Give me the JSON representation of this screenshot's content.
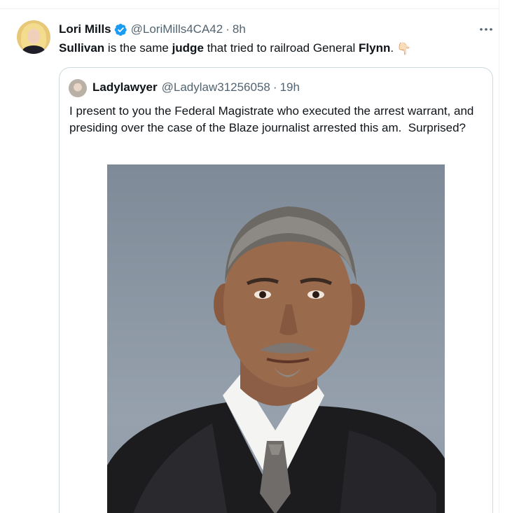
{
  "tweet": {
    "author_name": "Lori Mills",
    "handle": "@LoriMills4CA42",
    "separator": "·",
    "time": "8h",
    "more_icon": "more-horizontal-icon",
    "verified_icon": "verified-badge-icon",
    "text_parts": {
      "p1": "Sullivan",
      "p2": " is the same ",
      "p3": "judge",
      "p4": " that tried to railroad General ",
      "p5": "Flynn",
      "p6": "."
    },
    "emoji": "👇🏻"
  },
  "quote": {
    "author_name": "Ladylawyer",
    "handle": "@Ladylaw31256058",
    "separator": "·",
    "time": "19h",
    "text": "I present to you the Federal Magistrate who executed the arrest warrant, and presiding over the case of the Blaze journalist arrested this am.  Surprised?"
  },
  "colors": {
    "text_primary": "#0f1419",
    "text_secondary": "#536471",
    "verified_blue": "#1d9bf0",
    "border": "#cfd9de"
  }
}
